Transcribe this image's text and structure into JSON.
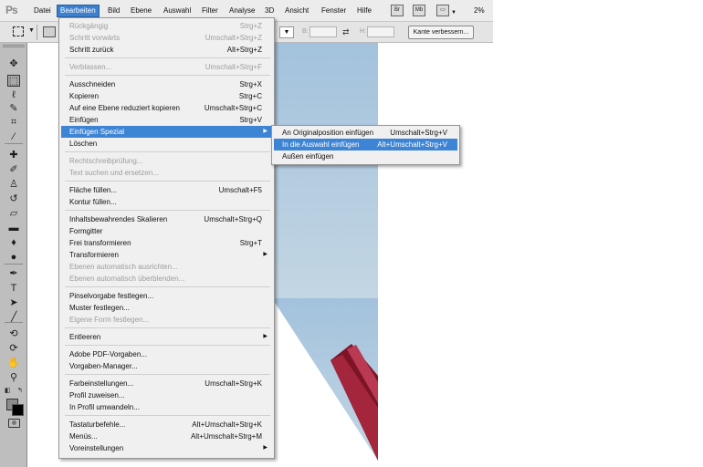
{
  "app": {
    "logo": "Ps",
    "zoom": "2%"
  },
  "menubar": {
    "items": [
      "Datei",
      "Bearbeiten",
      "Bild",
      "Ebene",
      "Auswahl",
      "Filter",
      "Analyse",
      "3D",
      "Ansicht",
      "Fenster",
      "Hilfe"
    ],
    "active": "Bearbeiten",
    "icons": [
      {
        "name": "bridge-icon",
        "label": "Br"
      },
      {
        "name": "mini-bridge-icon",
        "label": "Mb"
      },
      {
        "name": "screen-mode-icon",
        "label": "▭"
      }
    ]
  },
  "options": {
    "width_label": "B:",
    "height_label": "H:",
    "refine_edge_button": "Kante verbessern..."
  },
  "edit_menu": [
    {
      "label": "Rückgängig",
      "shortcut": "Strg+Z",
      "disabled": true
    },
    {
      "label": "Schritt vorwärts",
      "shortcut": "Umschalt+Strg+Z",
      "disabled": true
    },
    {
      "label": "Schritt zurück",
      "shortcut": "Alt+Strg+Z"
    },
    {
      "separator": true
    },
    {
      "label": "Verblassen...",
      "shortcut": "Umschalt+Strg+F",
      "disabled": true
    },
    {
      "separator": true
    },
    {
      "label": "Ausschneiden",
      "shortcut": "Strg+X"
    },
    {
      "label": "Kopieren",
      "shortcut": "Strg+C"
    },
    {
      "label": "Auf eine Ebene reduziert kopieren",
      "shortcut": "Umschalt+Strg+C"
    },
    {
      "label": "Einfügen",
      "shortcut": "Strg+V"
    },
    {
      "label": "Einfügen Spezial",
      "submenu": true,
      "highlighted": true
    },
    {
      "label": "Löschen"
    },
    {
      "separator": true
    },
    {
      "label": "Rechtschreibprüfung...",
      "disabled": true
    },
    {
      "label": "Text suchen und ersetzen...",
      "disabled": true
    },
    {
      "separator": true
    },
    {
      "label": "Fläche füllen...",
      "shortcut": "Umschalt+F5"
    },
    {
      "label": "Kontur füllen..."
    },
    {
      "separator": true
    },
    {
      "label": "Inhaltsbewahrendes Skalieren",
      "shortcut": "Umschalt+Strg+Q"
    },
    {
      "label": "Formgitter"
    },
    {
      "label": "Frei transformieren",
      "shortcut": "Strg+T"
    },
    {
      "label": "Transformieren",
      "submenu": true
    },
    {
      "label": "Ebenen automatisch ausrichten...",
      "disabled": true
    },
    {
      "label": "Ebenen automatisch überblenden...",
      "disabled": true
    },
    {
      "separator": true
    },
    {
      "label": "Pinselvorgabe festlegen..."
    },
    {
      "label": "Muster festlegen..."
    },
    {
      "label": "Eigene Form festlegen...",
      "disabled": true
    },
    {
      "separator": true
    },
    {
      "label": "Entleeren",
      "submenu": true
    },
    {
      "separator": true
    },
    {
      "label": "Adobe PDF-Vorgaben..."
    },
    {
      "label": "Vorgaben-Manager..."
    },
    {
      "separator": true
    },
    {
      "label": "Farbeinstellungen...",
      "shortcut": "Umschalt+Strg+K"
    },
    {
      "label": "Profil zuweisen..."
    },
    {
      "label": "In Profil umwandeln..."
    },
    {
      "separator": true
    },
    {
      "label": "Tastaturbefehle...",
      "shortcut": "Alt+Umschalt+Strg+K"
    },
    {
      "label": "Menüs...",
      "shortcut": "Alt+Umschalt+Strg+M"
    },
    {
      "label": "Voreinstellungen",
      "submenu": true
    }
  ],
  "paste_special_menu": [
    {
      "label": "An Originalposition einfügen",
      "shortcut": "Umschalt+Strg+V"
    },
    {
      "label": "In die Auswahl einfügen",
      "shortcut": "Alt+Umschalt+Strg+V",
      "highlighted": true
    },
    {
      "label": "Außen einfügen"
    }
  ],
  "tools": [
    {
      "name": "move-tool-icon",
      "glyph": "✥"
    },
    {
      "name": "rect-marquee-tool-icon",
      "glyph": "⬚",
      "selected": true
    },
    {
      "name": "lasso-tool-icon",
      "glyph": "ℓ"
    },
    {
      "name": "quick-selection-tool-icon",
      "glyph": "✎"
    },
    {
      "name": "crop-tool-icon",
      "glyph": "⌗"
    },
    {
      "name": "eyedropper-tool-icon",
      "glyph": "⁄"
    },
    {
      "name": "spot-healing-tool-icon",
      "glyph": "✚"
    },
    {
      "name": "brush-tool-icon",
      "glyph": "✐"
    },
    {
      "name": "clone-stamp-tool-icon",
      "glyph": "♙"
    },
    {
      "name": "history-brush-tool-icon",
      "glyph": "↺"
    },
    {
      "name": "eraser-tool-icon",
      "glyph": "▱"
    },
    {
      "name": "gradient-tool-icon",
      "glyph": "▬"
    },
    {
      "name": "blur-tool-icon",
      "glyph": "♦"
    },
    {
      "name": "dodge-tool-icon",
      "glyph": "●"
    },
    {
      "name": "pen-tool-icon",
      "glyph": "✒"
    },
    {
      "name": "type-tool-icon",
      "glyph": "T"
    },
    {
      "name": "path-selection-tool-icon",
      "glyph": "➤"
    },
    {
      "name": "line-tool-icon",
      "glyph": "╱"
    },
    {
      "name": "3d-rotate-tool-icon",
      "glyph": "⟲"
    },
    {
      "name": "3d-orbit-tool-icon",
      "glyph": "⟳"
    },
    {
      "name": "hand-tool-icon",
      "glyph": "✋"
    },
    {
      "name": "zoom-tool-icon",
      "glyph": "⚲"
    }
  ],
  "colors": {
    "accent": "#3e84d4",
    "canvas_band": "#a2c2dc",
    "shape": "#9a1d33"
  }
}
